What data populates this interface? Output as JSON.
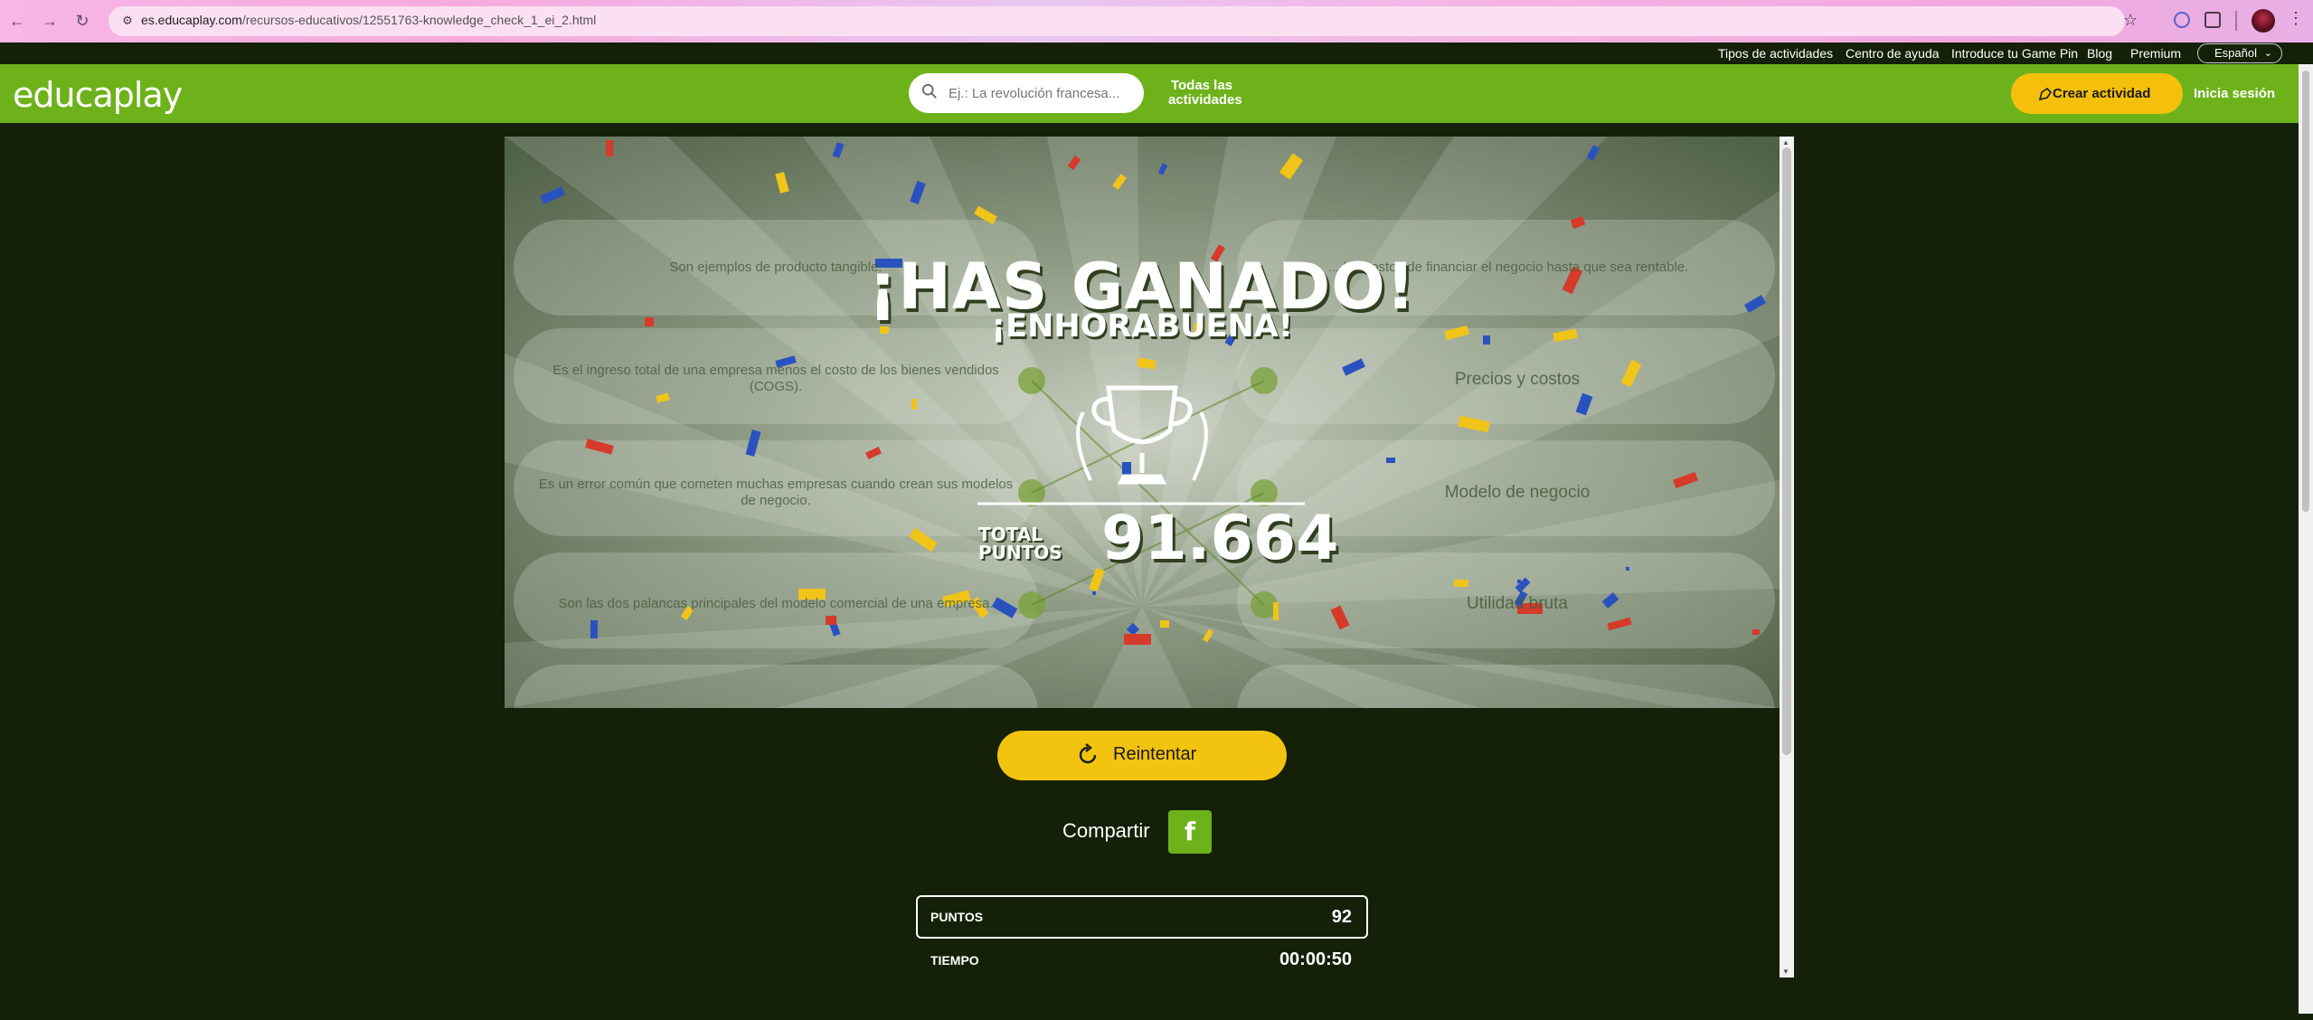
{
  "browser": {
    "url_domain": "es.educaplay.com",
    "url_path": "/recursos-educativos/12551763-knowledge_check_1_ei_2.html"
  },
  "top_links": [
    "Tipos de actividades",
    "Centro de ayuda",
    "Introduce tu Game Pin",
    "Blog",
    "Premium"
  ],
  "language": "Español",
  "header": {
    "logo": "educaplay",
    "search_placeholder": "Ej.: La revolución francesa...",
    "all_activities_line1": "Todas las",
    "all_activities_line2": "actividades",
    "create_label": "Crear actividad",
    "login_label": "Inicia sesión",
    "brand_color": "#6eb21b",
    "accent_color": "#f5c00c"
  },
  "game": {
    "questions": [
      "Son ejemplos de producto tangible:",
      "Es el ingreso total de una empresa menos el costo de los bienes vendidos (COGS).",
      "Es un error común que cometen muchas empresas cuando crean sus modelos de negocio.",
      "Son las dos palancas principales del modelo comercial de una empresa."
    ],
    "answers": [
      "... los costos de financiar el negocio hasta que sea rentable.",
      "Precios y costos",
      "Modelo de negocio",
      "Utilidad bruta"
    ],
    "win_title": "¡HAS GANADO!",
    "win_subtitle": "¡ENHORABUENA!",
    "total_label_1": "TOTAL",
    "total_label_2": "PUNTOS",
    "total_value": "91.664",
    "trophy_icon": "trophy-icon"
  },
  "actions": {
    "retry_label": "Reintentar",
    "share_label": "Compartir",
    "facebook_letter": "f"
  },
  "stats": {
    "points_label": "PUNTOS",
    "points_value": "92",
    "time_label": "TIEMPO",
    "time_value": "00:00:50"
  }
}
